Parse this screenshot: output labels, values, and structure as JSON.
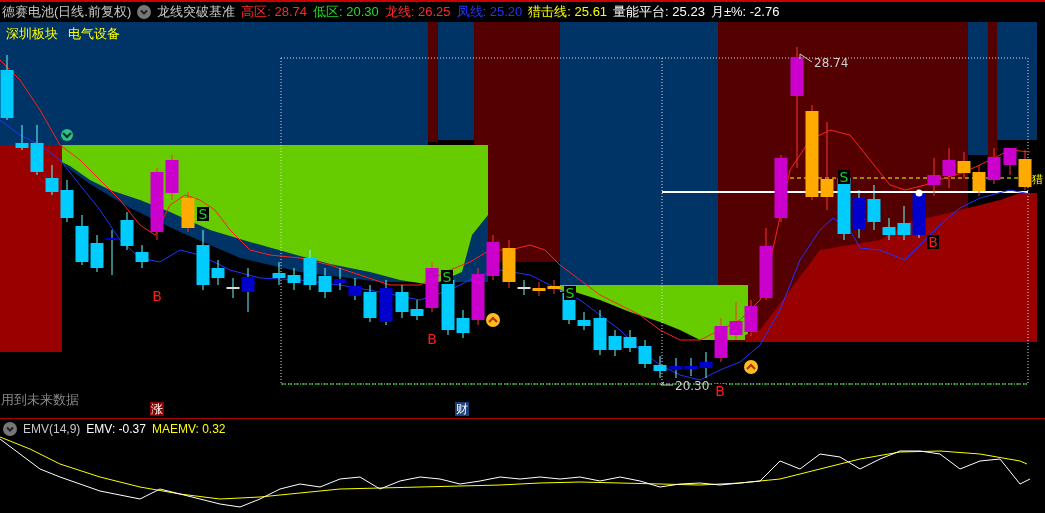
{
  "header": {
    "stock": "德赛电池(日线.前复权)",
    "indicator": "龙线突破基准",
    "readings": [
      {
        "text": "高区: 28.74",
        "kind": "high"
      },
      {
        "text": "低区: 20.30",
        "kind": "low"
      },
      {
        "text": "龙线: 26.25",
        "kind": "dragon"
      },
      {
        "text": "凤线: 25.20",
        "kind": "phoenix"
      },
      {
        "text": "猎击线: 25.61",
        "kind": "hunt"
      },
      {
        "text": "量能平台: 25.23",
        "kind": "platform"
      },
      {
        "text": "月±%: -2.76",
        "kind": "month"
      }
    ]
  },
  "sector_labels": [
    "深圳板块",
    "电气设备"
  ],
  "price_chart": {
    "high_label": "28.74",
    "low_label": "20.30",
    "right_edge_label": "猎",
    "signals": [
      {
        "text": "S",
        "kind": "sell"
      },
      {
        "text": "B",
        "kind": "buy"
      },
      {
        "text": "S",
        "kind": "sell"
      },
      {
        "text": "B",
        "kind": "buy"
      },
      {
        "text": "S",
        "kind": "sell"
      },
      {
        "text": "B",
        "kind": "buy"
      },
      {
        "text": "S",
        "kind": "sell"
      },
      {
        "text": "B",
        "kind": "buy"
      }
    ]
  },
  "future_data_note": "用到未来数据",
  "event_markers": [
    {
      "text": "涨",
      "color": "#8b0000"
    },
    {
      "text": "财",
      "color": "#1a3f7a"
    }
  ],
  "emv_panel": {
    "title": "EMV(14,9)",
    "readings": [
      {
        "text": "EMV: -0.37",
        "color": "#ffffff"
      },
      {
        "text": "MAEMV: 0.32",
        "color": "#ffff00"
      }
    ]
  }
}
